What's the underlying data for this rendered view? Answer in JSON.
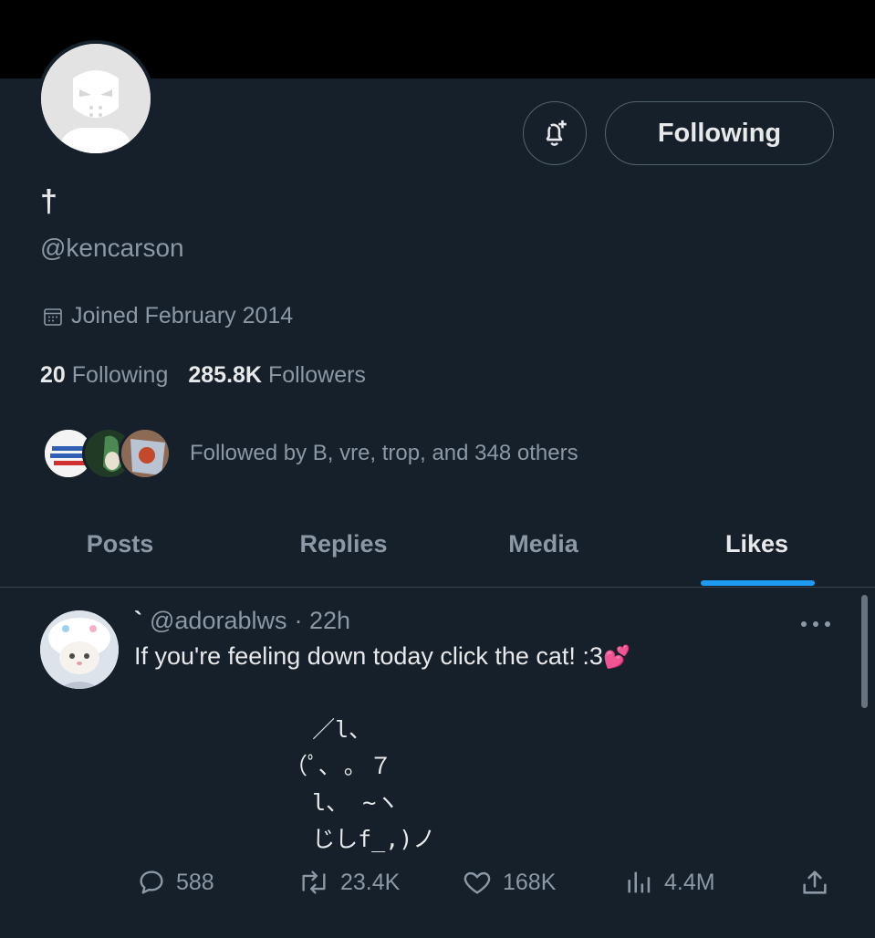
{
  "profile": {
    "display_name": "†",
    "handle": "@kencarson",
    "joined": "Joined February 2014",
    "following_count": "20",
    "following_label": "Following",
    "followers_count": "285.8K",
    "followers_label": "Followers",
    "followed_by": "Followed by B, vre, trop, and 348 others",
    "follow_button_label": "Following"
  },
  "tabs": [
    {
      "label": "Posts",
      "active": false
    },
    {
      "label": "Replies",
      "active": false
    },
    {
      "label": "Media",
      "active": false
    },
    {
      "label": "Likes",
      "active": true
    }
  ],
  "post": {
    "author_name": "`",
    "author_handle": "@adorablws",
    "time": "· 22h",
    "text": "If you're feeling down today click the cat! :3",
    "emoji": "💕",
    "ascii_art": "  ／l、\n（ﾟ､ ｡ ７\n  l、 ~ヽ\n  じしf_,)ノ",
    "replies": "588",
    "reposts": "23.4K",
    "likes": "168K",
    "views": "4.4M"
  },
  "icons": {
    "bell": "bell-plus-icon",
    "calendar": "calendar-icon",
    "more": "more-icon",
    "reply": "reply-icon",
    "repost": "repost-icon",
    "like": "heart-icon",
    "views": "views-icon",
    "share": "share-icon"
  },
  "colors": {
    "background": "#15202b",
    "accent": "#1d9bf0",
    "muted_text": "#8b98a5",
    "text": "#e7e9ea"
  }
}
